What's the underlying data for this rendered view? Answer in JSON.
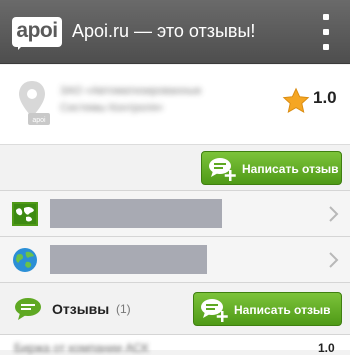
{
  "header": {
    "logo_text": "apoi",
    "title": "Apoi.ru — это отзывы!"
  },
  "company": {
    "name_line1": "ЗАО «Автоматизированные",
    "name_line2": "Системы Контроля»",
    "rating": "1.0"
  },
  "write_review": {
    "label": "Написать отзыв"
  },
  "links": [
    {
      "icon": "map-icon"
    },
    {
      "icon": "globe-icon"
    }
  ],
  "reviews": {
    "label": "Отзывы",
    "count": "(1)",
    "button_label": "Написать отзыв"
  },
  "first_review": {
    "text": "Биржа от компании АСК",
    "rating": "1.0"
  },
  "colors": {
    "header_bg": "#555555",
    "accent_green": "#5fa823",
    "star": "#f5a623"
  }
}
